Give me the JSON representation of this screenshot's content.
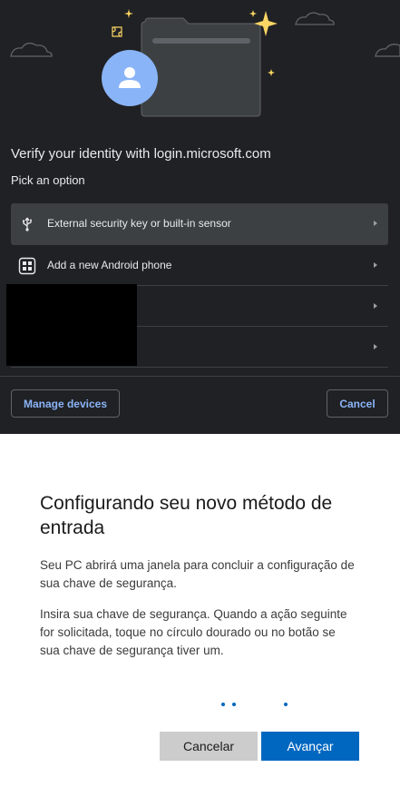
{
  "dialog": {
    "title": "Verify your identity with login.microsoft.com",
    "subtitle": "Pick an option",
    "options": [
      {
        "label": "External security key or built-in sensor",
        "icon": "usb-icon",
        "selected": true
      },
      {
        "label": "Add a new Android phone",
        "icon": "qr-phone-icon",
        "selected": false
      },
      {
        "label": "",
        "icon": "",
        "selected": false
      },
      {
        "label": "",
        "icon": "",
        "selected": false
      }
    ],
    "manage_label": "Manage devices",
    "cancel_label": "Cancel",
    "colors": {
      "background": "#202124",
      "accent": "#8ab4f8",
      "avatar": "#8ab4f8",
      "sparkle": "#fdd663"
    }
  },
  "pane": {
    "heading": "Configurando seu novo método de entrada",
    "paragraph1": "Seu PC abrirá uma janela para concluir a configuração de sua chave de segurança.",
    "paragraph2": "Insira sua chave de segurança. Quando a ação seguinte for solicitada, toque no círculo dourado ou no botão se sua chave de segurança tiver um.",
    "cancel_label": "Cancelar",
    "next_label": "Avançar",
    "colors": {
      "primary": "#0067c0",
      "secondary": "#cccccc"
    }
  }
}
